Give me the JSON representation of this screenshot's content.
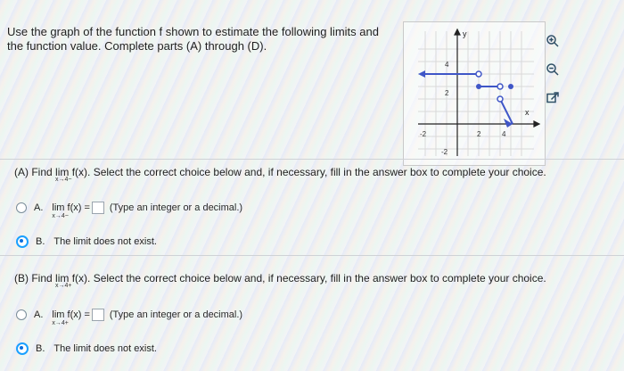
{
  "question": {
    "text": "Use the graph of the function f shown to estimate the following limits and the function value. Complete parts (A) through (D)."
  },
  "graph": {
    "axis_label_y": "y",
    "axis_label_x": "x",
    "tick_labels": {
      "x_neg2": "-2",
      "x_2": "2",
      "x_4": "4",
      "y_4": "4",
      "y_2": "2",
      "y_neg2": "-2"
    }
  },
  "icons": {
    "zoom_in": "zoom-in-icon",
    "zoom_out": "zoom-out-icon",
    "external": "external-link-icon"
  },
  "partA": {
    "title_prefix": "(A) Find",
    "lim": "lim f(x).",
    "sub": "x→4−",
    "title_suffix": "Select the correct choice below and, if necessary, fill in the answer box to complete your choice.",
    "optionA_label": "A.",
    "optionA_lim": "lim f(x) =",
    "optionA_sub": "x→4−",
    "optionA_hint": "(Type an integer or a decimal.)",
    "optionB_label": "B.",
    "optionB_text": "The limit does not exist."
  },
  "partB": {
    "title_prefix": "(B) Find",
    "lim": "lim f(x).",
    "sub": "x→4+",
    "title_suffix": "Select the correct choice below and, if necessary, fill in the answer box to complete your choice.",
    "optionA_label": "A.",
    "optionA_lim": "lim f(x) =",
    "optionA_sub": "x→4+",
    "optionA_hint": "(Type an integer or a decimal.)",
    "optionB_label": "B.",
    "optionB_text": "The limit does not exist."
  }
}
